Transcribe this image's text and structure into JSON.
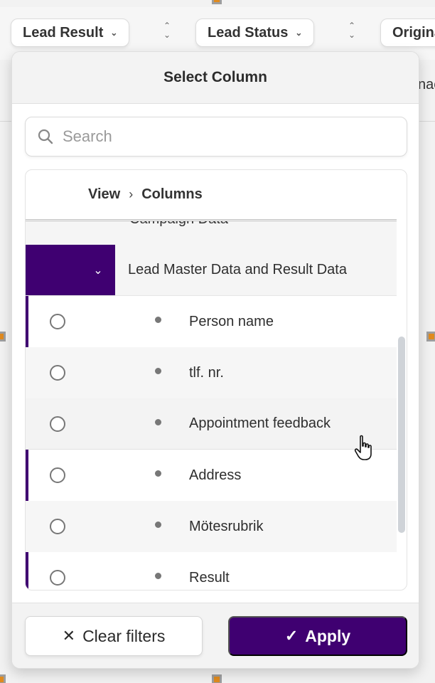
{
  "toolbar": {
    "columns": [
      {
        "label": "Lead Result"
      },
      {
        "label": "Lead Status"
      },
      {
        "label": "Origina"
      }
    ],
    "peek_text": "nae"
  },
  "popup": {
    "title": "Select Column",
    "search": {
      "placeholder": "Search",
      "value": ""
    },
    "breadcrumb": {
      "view": "View",
      "columns": "Columns"
    },
    "cut_group_label": "Campaign Data",
    "group": {
      "label": "Lead Master Data and Result Data",
      "expanded": true
    },
    "items": [
      {
        "label": "Person name",
        "selected": false
      },
      {
        "label": "tlf. nr.",
        "selected": false
      },
      {
        "label": "Appointment feedback",
        "selected": false
      },
      {
        "label": "Address",
        "selected": false
      },
      {
        "label": "Mötesrubrik",
        "selected": false
      },
      {
        "label": "Result",
        "selected": false
      }
    ],
    "footer": {
      "clear_label": "Clear filters",
      "apply_label": "Apply"
    }
  },
  "colors": {
    "accent": "#3f0071",
    "marker": "#e08a1e"
  },
  "icons": {
    "search": "search-icon",
    "chevron": "chevron-down-icon",
    "close": "close-icon",
    "check": "check-icon"
  }
}
